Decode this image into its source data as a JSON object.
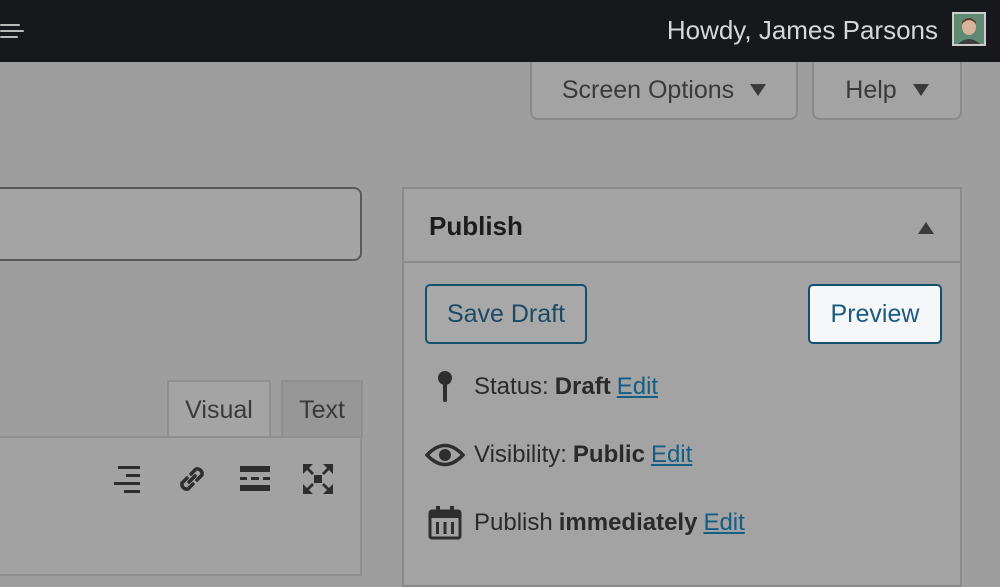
{
  "adminbar": {
    "greeting": "Howdy, James Parsons"
  },
  "screen_meta": {
    "screen_options_label": "Screen Options",
    "help_label": "Help"
  },
  "editor": {
    "tabs": [
      {
        "label": "Visual"
      },
      {
        "label": "Text"
      }
    ],
    "toolbar": [
      "align-right-icon",
      "link-icon",
      "read-more-icon",
      "fullscreen-icon"
    ]
  },
  "publish": {
    "title": "Publish",
    "save_draft_label": "Save Draft",
    "preview_label": "Preview",
    "status": {
      "label": "Status:",
      "value": "Draft",
      "edit": "Edit"
    },
    "visibility": {
      "label": "Visibility:",
      "value": "Public",
      "edit": "Edit"
    },
    "schedule": {
      "label": "Publish",
      "value": "immediately",
      "edit": "Edit"
    }
  },
  "colors": {
    "adminbar": "#17181c",
    "link": "#145d85",
    "button_border": "#14506e"
  }
}
